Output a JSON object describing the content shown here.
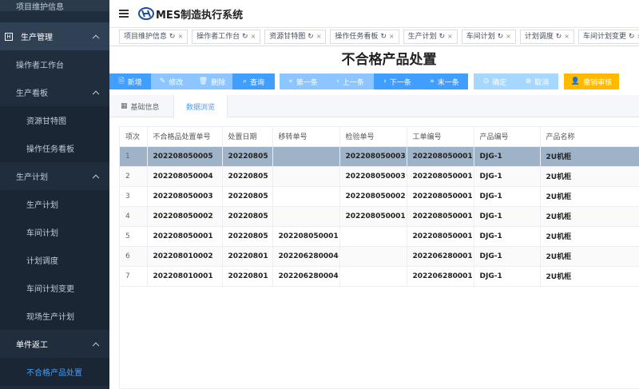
{
  "sidebar": {
    "items": [
      {
        "label": "项目维护信息",
        "kind": "top-partial"
      },
      {
        "label": "生产管理",
        "kind": "group-hl",
        "icon": "module-icon",
        "chevron": true
      },
      {
        "label": "操作者工作台",
        "kind": "lv1"
      },
      {
        "label": "生产看板",
        "kind": "lv1",
        "chevron": true
      },
      {
        "label": "资源甘特图",
        "kind": "lv2"
      },
      {
        "label": "操作任务看板",
        "kind": "lv2"
      },
      {
        "label": "生产计划",
        "kind": "lv1",
        "chevron": true
      },
      {
        "label": "生产计划",
        "kind": "lv2"
      },
      {
        "label": "车间计划",
        "kind": "lv2"
      },
      {
        "label": "计划调度",
        "kind": "lv2"
      },
      {
        "label": "车间计划变更",
        "kind": "lv2"
      },
      {
        "label": "现场生产计划",
        "kind": "lv2"
      },
      {
        "label": "单件返工",
        "kind": "lv1 group",
        "chevron": true
      },
      {
        "label": "不合格产品处置",
        "kind": "lv2 active"
      }
    ]
  },
  "header": {
    "app_title": "MES制造执行系统"
  },
  "tabs": [
    {
      "label": "项目维护信息"
    },
    {
      "label": "操作者工作台"
    },
    {
      "label": "资源甘特图"
    },
    {
      "label": "操作任务看板"
    },
    {
      "label": "生产计划"
    },
    {
      "label": "车间计划"
    },
    {
      "label": "计划调度"
    },
    {
      "label": "车间计划变更"
    }
  ],
  "page": {
    "title": "不合格产品处置"
  },
  "toolbar": {
    "add": "新增",
    "edit": "修改",
    "delete": "删除",
    "query": "查询",
    "first": "第一条",
    "prev": "上一条",
    "next": "下一条",
    "last": "末一条",
    "confirm": "确定",
    "cancel": "取消",
    "revoke": "撤销审核"
  },
  "inner_tabs": {
    "basic": "基础信息",
    "browse": "数据浏览"
  },
  "table": {
    "headers": [
      "项次",
      "不合格品处置单号",
      "处置日期",
      "移转单号",
      "检验单号",
      "工单编号",
      "产品编号",
      "产品名称"
    ],
    "rows": [
      [
        "1",
        "202208050005",
        "20220805",
        "",
        "202208050003",
        "202208050001",
        "DJG-1",
        "2U机柜"
      ],
      [
        "2",
        "202208050004",
        "20220805",
        "",
        "202208050003",
        "202208050001",
        "DJG-1",
        "2U机柜"
      ],
      [
        "3",
        "202208050003",
        "20220805",
        "",
        "202208050002",
        "202208050001",
        "DJG-1",
        "2U机柜"
      ],
      [
        "4",
        "202208050002",
        "20220805",
        "",
        "202208050001",
        "202208050001",
        "DJG-1",
        "2U机柜"
      ],
      [
        "5",
        "202208050001",
        "20220805",
        "202208050001",
        "",
        "202208050001",
        "DJG-1",
        "2U机柜"
      ],
      [
        "6",
        "202208010002",
        "20220801",
        "202206280004",
        "",
        "202206280001",
        "DJG-1",
        "2U机柜"
      ],
      [
        "7",
        "202208010001",
        "20220801",
        "202206280004",
        "",
        "202206280001",
        "DJG-1",
        "2U机柜"
      ]
    ],
    "selected_row": 0
  },
  "colors": {
    "primary": "#409eff",
    "light": "#8cc5ff",
    "warn": "#ffba00",
    "sidebar": "#1f2d3d",
    "selected": "#9fb3c8"
  }
}
